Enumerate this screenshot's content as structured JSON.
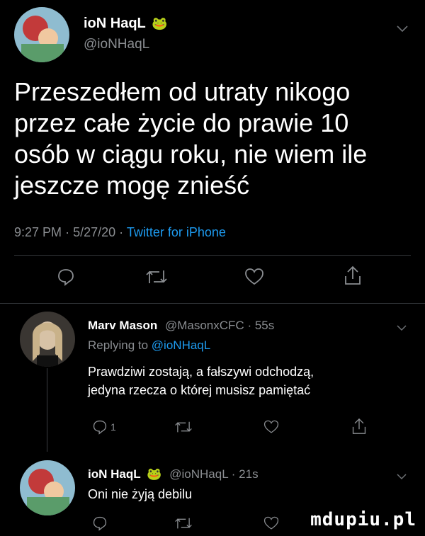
{
  "main_tweet": {
    "display_name": "ioN HaqL",
    "emoji": "🐸",
    "handle": "@ioNHaqL",
    "text_lines": [
      "Przeszedłem od utraty nikogo",
      "przez całe życie do prawie 10",
      "osób w ciągu roku, nie wiem ile",
      "jeszcze mogę znieść"
    ],
    "time": "9:27 PM",
    "date": "5/27/20",
    "source": "Twitter for iPhone"
  },
  "reply1": {
    "display_name": "Marv Mason",
    "handle": "@MasonxCFC",
    "age": "55s",
    "replying_to_label": "Replying to",
    "replying_to_handle": "@ioNHaqL",
    "text_line1": "Prawdziwi zostają, a fałszywi odchodzą,",
    "text_line2": "jedyna rzecza o której musisz pamiętać",
    "reply_count": "1"
  },
  "reply2": {
    "display_name": "ioN HaqL",
    "emoji": "🐸",
    "handle": "@ioNHaqL",
    "age": "21s",
    "text": "Oni nie żyją debilu"
  },
  "watermark": "mdupiu.pl",
  "colors": {
    "background": "#000000",
    "link": "#1d9bf0",
    "muted": "#8a8d91"
  }
}
